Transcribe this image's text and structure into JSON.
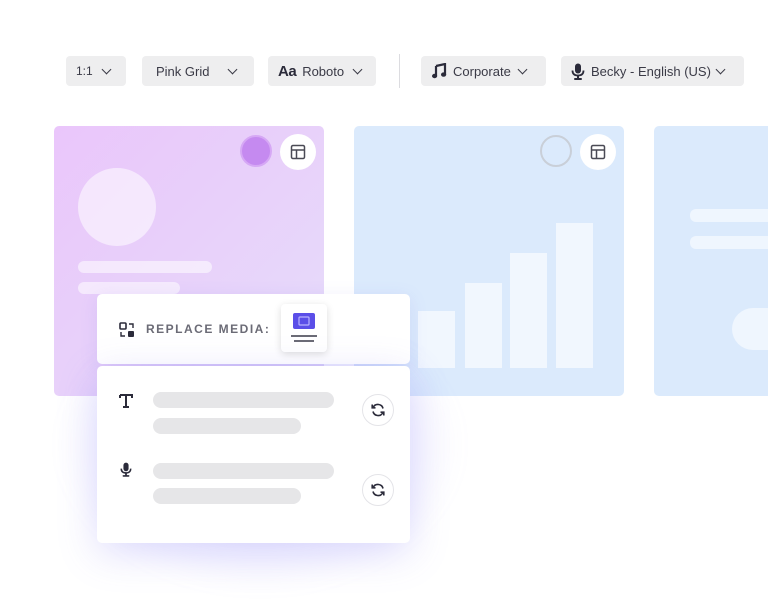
{
  "toolbar": {
    "aspect_ratio": "1:1",
    "template": "Pink Grid",
    "font_icon_text": "Aa",
    "font": "Roboto",
    "music": "Corporate",
    "voice": "Becky - English (US)"
  },
  "replace_media": {
    "label": "REPLACE MEDIA:"
  },
  "colors": {
    "accent": "#5b4ee8",
    "swatch_purple": "#c58af0",
    "card_pink": "#ead0fb",
    "card_blue": "#dbeafc"
  },
  "chart_bars": {
    "values": [
      57,
      85,
      115,
      145
    ]
  },
  "icons": [
    "chevron-down-icon",
    "music-note-icon",
    "microphone-icon",
    "layout-icon",
    "replace-icon",
    "text-icon",
    "refresh-icon",
    "image-icon"
  ]
}
